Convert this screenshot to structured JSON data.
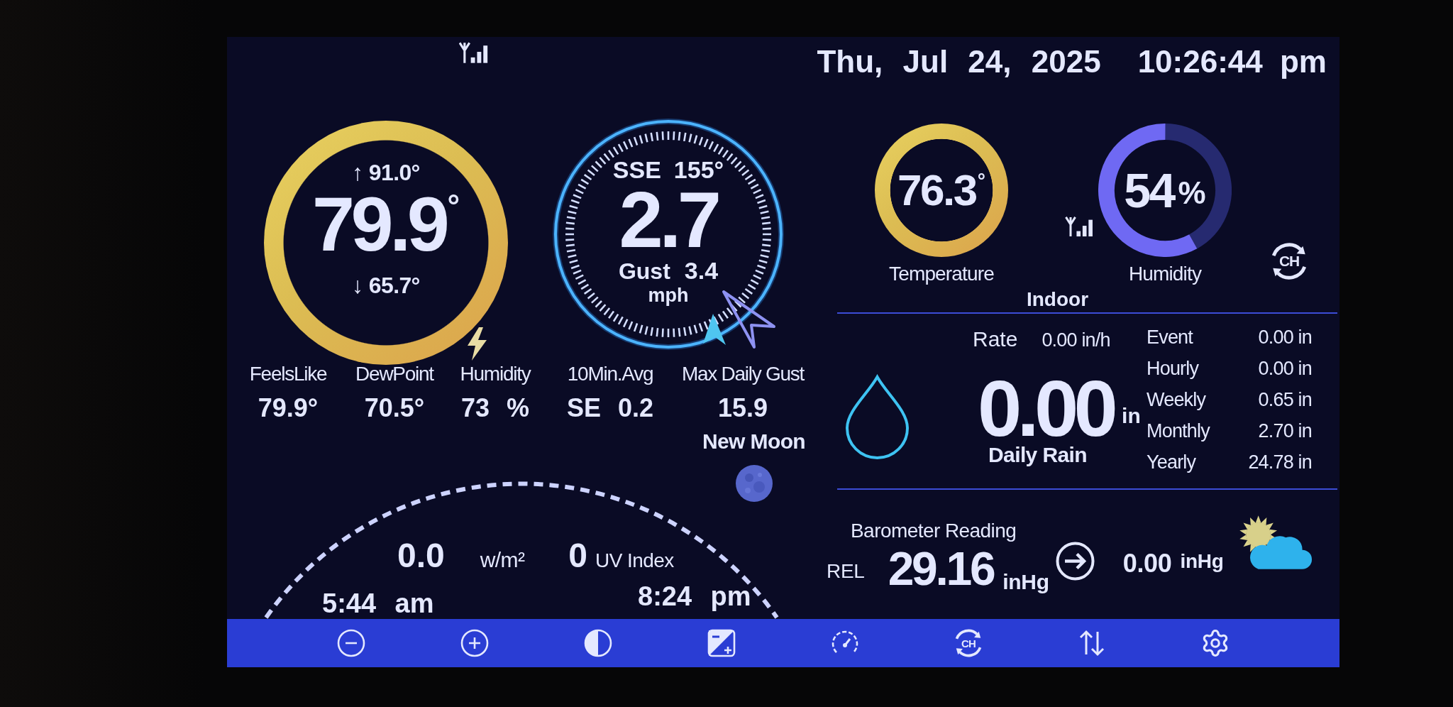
{
  "header": {
    "date": "Thu, Jul 24, 2025",
    "time": "10:26:44 pm"
  },
  "outdoor": {
    "high": "↑ 91.0°",
    "temperature": "79.9",
    "degree": "°",
    "low": "↓ 65.7°",
    "readings": [
      {
        "label": "FeelsLike",
        "value": "79.9°"
      },
      {
        "label": "DewPoint",
        "value": "70.5°"
      },
      {
        "label": "Humidity",
        "value": "73 %"
      }
    ]
  },
  "wind": {
    "direction": "SSE",
    "bearing": "155°",
    "speed": "2.7",
    "gust_label": "Gust",
    "gust": "3.4",
    "unit": "mph",
    "readings": [
      {
        "label": "10Min.Avg",
        "value": "SE 0.2"
      },
      {
        "label": "Max Daily Gust",
        "value": "15.9"
      }
    ]
  },
  "moon": {
    "phase": "New Moon"
  },
  "solar": {
    "radiation": "0.0",
    "radiation_unit": "w/m²",
    "uv": "0",
    "uv_label": "UV Index",
    "sunrise": "5:44 am",
    "sunset": "8:24 pm"
  },
  "indoor": {
    "title": "Indoor",
    "temperature": {
      "value": "76.3",
      "unit": "°",
      "label": "Temperature"
    },
    "humidity": {
      "value": "54",
      "unit": "%",
      "label": "Humidity",
      "level": 0.58
    },
    "channel_button": "CH"
  },
  "rain": {
    "rate_label": "Rate",
    "rate": "0.00 in/h",
    "daily": "0.00",
    "daily_unit": "in",
    "daily_label": "Daily Rain",
    "totals": [
      {
        "label": "Event",
        "value": "0.00 in"
      },
      {
        "label": "Hourly",
        "value": "0.00 in"
      },
      {
        "label": "Weekly",
        "value": "0.65 in"
      },
      {
        "label": "Monthly",
        "value": "2.70 in"
      },
      {
        "label": "Yearly",
        "value": "24.78 in"
      }
    ]
  },
  "barometer": {
    "title": "Barometer Reading",
    "mode": "REL",
    "pressure": "29.16",
    "unit": "inHg",
    "change": "0.00",
    "change_unit": "inHg"
  },
  "toolbar": [
    {
      "kind": "zoom_out"
    },
    {
      "kind": "zoom_in"
    },
    {
      "kind": "contrast"
    },
    {
      "kind": "exposure"
    },
    {
      "kind": "gauge"
    },
    {
      "kind": "channel",
      "label": "CH"
    },
    {
      "kind": "swap"
    },
    {
      "kind": "settings"
    }
  ]
}
